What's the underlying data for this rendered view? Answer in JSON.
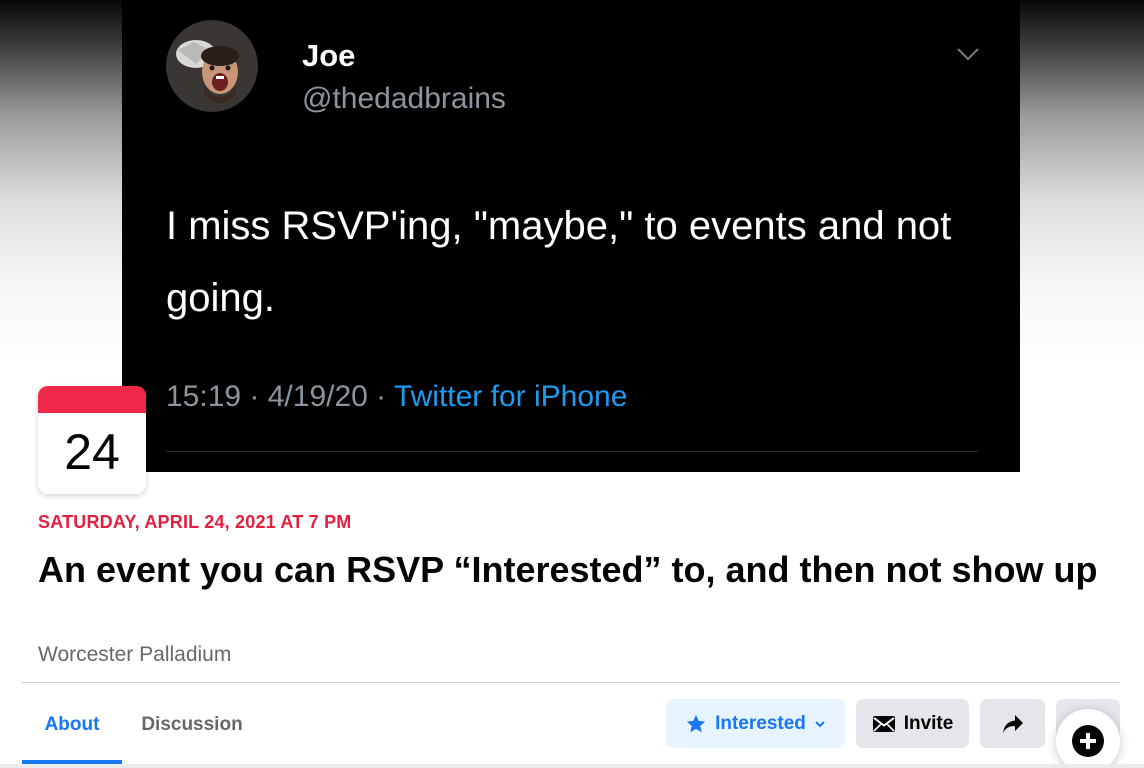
{
  "tweet": {
    "name": "Joe",
    "handle": "@thedadbrains",
    "text": "I miss RSVP'ing, \"maybe,\" to events and not going.",
    "meta_time": "15:19 · 4/19/20 · ",
    "meta_source": "Twitter for iPhone"
  },
  "event": {
    "day": "24",
    "date_line": "SATURDAY, APRIL 24, 2021 AT 7 PM",
    "title": "An event you can RSVP “Interested” to, and then not show up",
    "venue": "Worcester Palladium"
  },
  "tabs": [
    {
      "label": "About",
      "active": true
    },
    {
      "label": "Discussion",
      "active": false
    }
  ],
  "actions": {
    "interested_label": "Interested",
    "invite_label": "Invite"
  },
  "icons": {
    "interested": "star-icon",
    "interested_menu": "chevron-down-icon",
    "invite": "envelope-icon",
    "share": "share-arrow-icon",
    "more": "ellipsis-icon",
    "create": "plus-circle-icon",
    "tweet_menu": "chevron-down-icon"
  },
  "colors": {
    "accent": "#1877f2",
    "date_red": "#e41e3f",
    "calendar_red": "#f02849",
    "twitter_blue": "#1d9bf0"
  }
}
